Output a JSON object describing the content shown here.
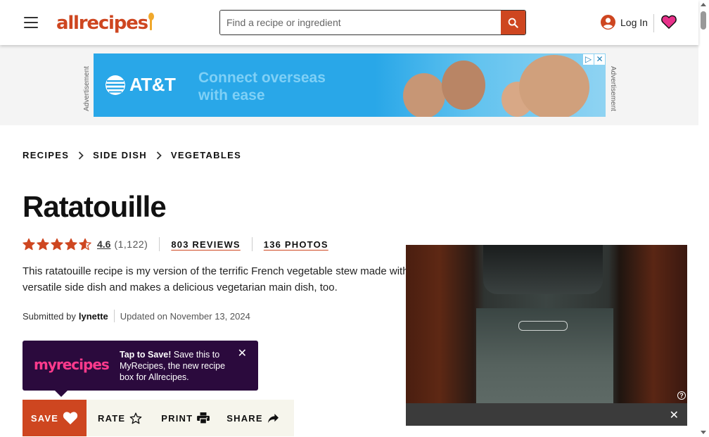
{
  "header": {
    "logo_text": "allrecipes",
    "search_placeholder": "Find a recipe or ingredient",
    "login_label": "Log In"
  },
  "ad": {
    "label": "Advertisement",
    "brand": "AT&T",
    "copy_line1": "Connect overseas",
    "copy_line2": "with ease"
  },
  "breadcrumb": [
    "RECIPES",
    "SIDE DISH",
    "VEGETABLES"
  ],
  "recipe": {
    "title": "Ratatouille",
    "rating": "4.6",
    "rating_count": "(1,122)",
    "rating_value": 4.6,
    "reviews_label": "803 REVIEWS",
    "photos_label": "136 PHOTOS",
    "description": "This ratatouille recipe is my version of the terrific French vegetable stew made with versatile side dish and makes a delicious vegetarian main dish, too.",
    "submitted_by_label": "Submitted by",
    "author": "lynette",
    "updated": "Updated on November 13, 2024"
  },
  "tooltip": {
    "logo": "myrecipes",
    "headline": "Tap to Save!",
    "text": " Save this to MyRecipes, the new recipe box for Allrecipes."
  },
  "actions": {
    "save": "SAVE",
    "rate": "RATE",
    "print": "PRINT",
    "share": "SHARE"
  },
  "colors": {
    "brand": "#ce4620",
    "tooltip_bg": "#2b0a3d",
    "heart": "#e8318a"
  }
}
